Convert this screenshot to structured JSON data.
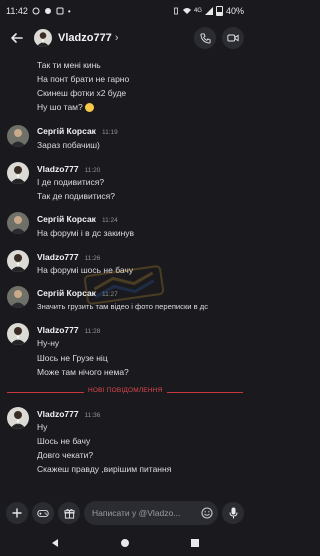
{
  "status_bar": {
    "time": "11:42",
    "battery": "40%",
    "network": "4G"
  },
  "header": {
    "title": "Vladzo777",
    "chevron": "›"
  },
  "messages": {
    "top_lines": [
      "Так ти мені кинь",
      "На понт брати не гарно",
      "Скинеш фотки х2 буде",
      "Ну шо там?"
    ],
    "m1": {
      "author": "Сергій Корсак",
      "time": "11:19",
      "lines": [
        "Зараз побачиш)"
      ]
    },
    "m2": {
      "author": "Vladzo777",
      "time": "11:20",
      "lines": [
        "І де подивитися?",
        "Так де подивитися?"
      ]
    },
    "m3": {
      "author": "Сергій Корсак",
      "time": "11:24",
      "lines": [
        "На форумі і в дс закинув"
      ]
    },
    "m4": {
      "author": "Vladzo777",
      "time": "11:26",
      "lines": [
        "На форумі шось не бачу"
      ]
    },
    "m5": {
      "author": "Сергій Корсак",
      "time": "11:27",
      "lines": [
        "Значить грузить там відео і фото переписки в дс"
      ]
    },
    "m6": {
      "author": "Vladzo777",
      "time": "11:28",
      "lines": [
        "Ну-ну",
        "Шось не Грузе ніц",
        "Може там нічого нема?"
      ]
    },
    "m7": {
      "author": "Vladzo777",
      "time": "11:36",
      "lines": [
        "Ну",
        "Шось не бачу",
        "Довго чекати?",
        "Скажеш правду ,вирішим питання"
      ]
    }
  },
  "divider": {
    "label": "НОВІ ПОВІДОМЛЕННЯ"
  },
  "composer": {
    "placeholder": "Написати у @Vladzo..."
  },
  "colors": {
    "background": "#1a1a1e",
    "divider": "#e0474f",
    "text": "#dcdde1"
  }
}
